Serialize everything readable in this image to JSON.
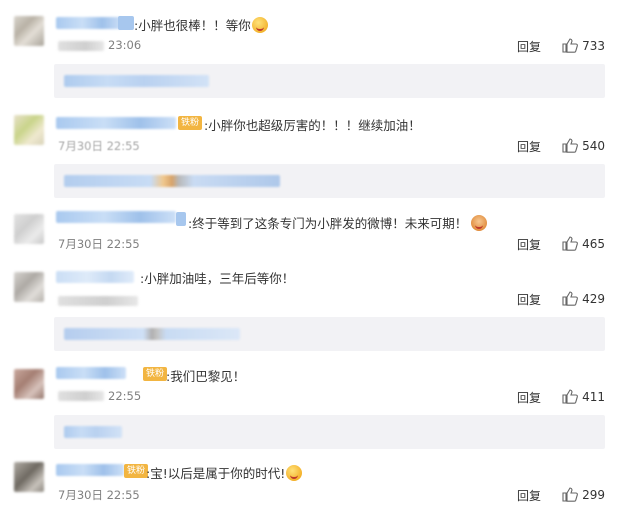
{
  "comments": [
    {
      "badge": "",
      "text": ":小胖也很棒！！等你",
      "emoji": "crying-laugh-emoji",
      "time": "23:06",
      "reply": "回复",
      "likes": "733"
    },
    {
      "badge": "铁粉",
      "text": ":小胖你也超级厉害的！！！继续加油！",
      "emoji": "",
      "time": "7月30日 22:55",
      "reply": "回复",
      "likes": "540"
    },
    {
      "badge": "",
      "text": ":终于等到了这条专门为小胖发的微博！未来可期！",
      "emoji": "steamed-bun-emoji",
      "time": "7月30日 22:55",
      "reply": "回复",
      "likes": "465"
    },
    {
      "badge": "",
      "text": ":小胖加油哇，三年后等你！",
      "emoji": "",
      "time": "",
      "reply": "回复",
      "likes": "429"
    },
    {
      "badge": "铁粉",
      "text": ":我们巴黎见！",
      "emoji": "",
      "time": "22:55",
      "reply": "回复",
      "likes": "411"
    },
    {
      "badge": "铁粉",
      "text": ":宝!以后是属于你的时代!",
      "emoji": "kiss-emoji",
      "time": "7月30日 22:55",
      "reply": "回复",
      "likes": "299"
    }
  ],
  "colors": {
    "text": "#333333",
    "time": "#808080",
    "sub_reply_bg": "#f2f2f5",
    "fan_badge": "#f2b541"
  }
}
